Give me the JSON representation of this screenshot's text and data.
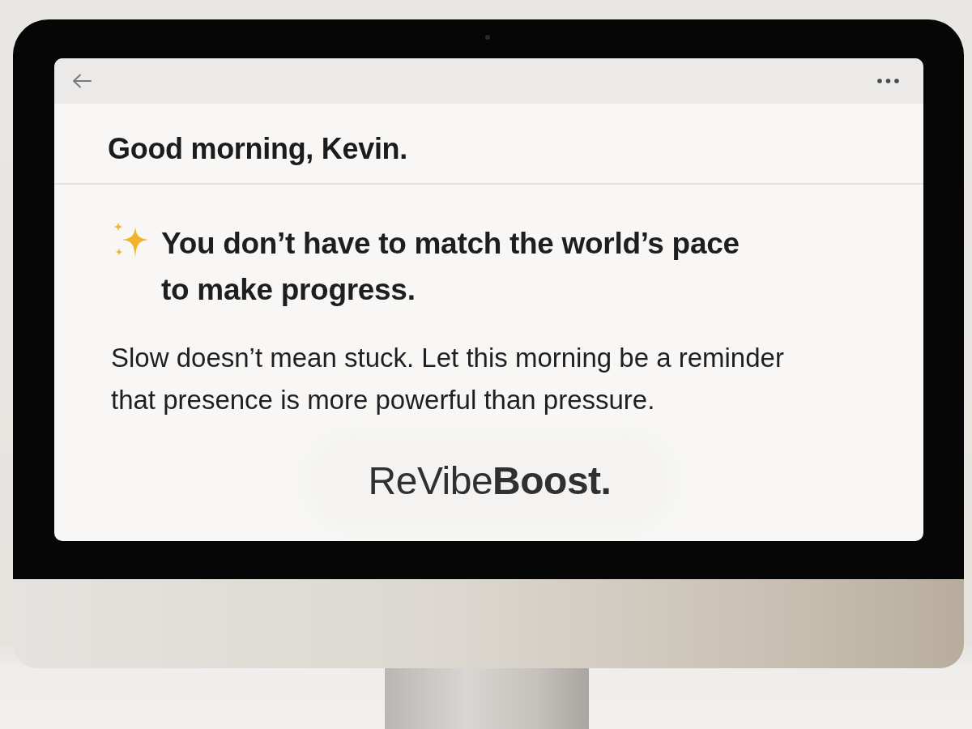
{
  "greeting": "Good morning, Kevin.",
  "message": {
    "headline": "You don’t have to match the world’s pace to make progress.",
    "body": "Slow doesn’t mean stuck. Let this morning be a reminder that presence is more powerful than pressure."
  },
  "brand": "ReVibe**Boost.**"
}
